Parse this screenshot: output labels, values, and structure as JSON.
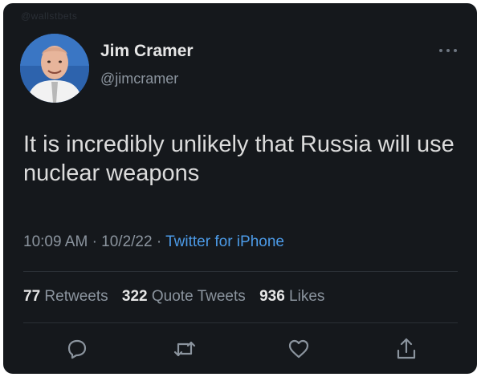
{
  "watermark": "@wallstbets",
  "author": {
    "name": "Jim Cramer",
    "handle": "@jimcramer"
  },
  "menu_icon": "more-dots-icon",
  "tweet": {
    "text": "It is incredibly unlikely that Russia will use nuclear weapons",
    "time": "10:09 AM",
    "date": "10/2/22",
    "separator": "·",
    "source": "Twitter for iPhone"
  },
  "stats": {
    "retweets_count": "77",
    "retweets_label": "Retweets",
    "quotes_count": "322",
    "quotes_label": "Quote Tweets",
    "likes_count": "936",
    "likes_label": "Likes"
  },
  "actions": {
    "reply_icon": "reply-icon",
    "retweet_icon": "retweet-icon",
    "like_icon": "heart-icon",
    "share_icon": "share-icon"
  },
  "colors": {
    "background": "#15181c",
    "text": "#dcdcdc",
    "muted": "#8b949e",
    "link": "#4c9be8",
    "divider": "#2b3036"
  }
}
